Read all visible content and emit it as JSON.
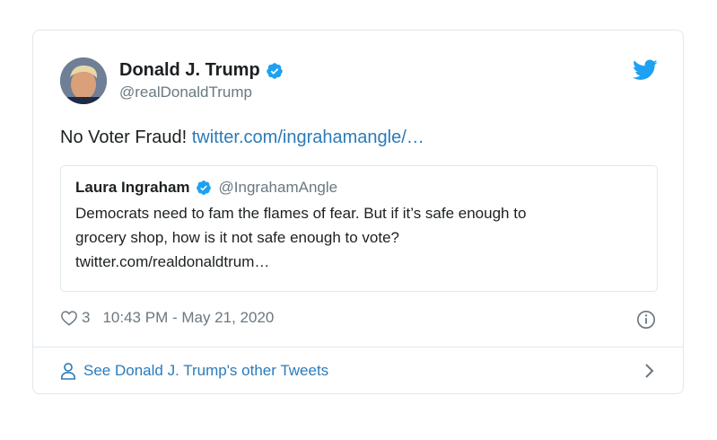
{
  "tweet": {
    "author": {
      "display_name": "Donald J. Trump",
      "handle": "@realDonaldTrump",
      "verified": true
    },
    "text": "No Voter Fraud! ",
    "link_text": "twitter.com/ingrahamangle/…",
    "quoted": {
      "display_name": "Laura Ingraham",
      "handle": "@IngrahamAngle",
      "verified": true,
      "text_line1": "Democrats need to fam the flames of fear.  But if it’s safe enough to",
      "text_line2": "grocery shop, how is it not safe enough to vote?",
      "text_line3": "twitter.com/realdonaldtrum…"
    },
    "like_count": "3",
    "timestamp": "10:43 PM - May 21, 2020",
    "footer_link": "See Donald J. Trump's other Tweets"
  },
  "icons": {
    "verified": "verified-badge-icon",
    "brand": "twitter-bird-icon",
    "like": "heart-icon",
    "info": "info-icon",
    "profile": "person-icon",
    "more": "chevron-right-icon"
  },
  "colors": {
    "link": "#2b7bb9",
    "verified": "#1da1f2",
    "muted": "#697882",
    "border": "#e1e8ed"
  }
}
